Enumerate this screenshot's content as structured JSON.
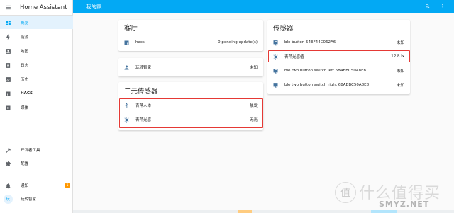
{
  "sidebar": {
    "title": "Home Assistant",
    "items": [
      {
        "label": "概览",
        "icon": "dashboard-icon"
      },
      {
        "label": "能源",
        "icon": "lightning-icon"
      },
      {
        "label": "地图",
        "icon": "map-person-icon"
      },
      {
        "label": "日志",
        "icon": "logbook-icon"
      },
      {
        "label": "历史",
        "icon": "history-chart-icon"
      },
      {
        "label": "HACS",
        "icon": "hacs-icon"
      },
      {
        "label": "媒体",
        "icon": "media-icon"
      }
    ],
    "bottom_items": [
      {
        "label": "开发者工具",
        "icon": "hammer-icon"
      },
      {
        "label": "配置",
        "icon": "gear-icon"
      }
    ],
    "notifications": {
      "label": "通知",
      "count": "1"
    },
    "user": {
      "name": "玩转智家",
      "initial": "玩"
    }
  },
  "header": {
    "title": "我的家"
  },
  "cards": {
    "living_room": {
      "title": "客厅",
      "rows": [
        {
          "name": "hacs",
          "state": "0 pending update(s)"
        }
      ]
    },
    "person": {
      "rows": [
        {
          "name": "玩转智家",
          "state": "未知"
        }
      ]
    },
    "binary_sensors": {
      "title": "二元传感器",
      "rows": [
        {
          "name": "青萍人体",
          "state": "触发"
        },
        {
          "name": "青萍光感",
          "state": "无光"
        }
      ]
    },
    "sensors": {
      "title": "传感器",
      "rows": [
        {
          "name": "ble button 54EF44C062A6",
          "state": "未知"
        },
        {
          "name": "青萍光感值",
          "state": "12.8 lx"
        },
        {
          "name": "ble two button switch left 68ABBC50A8E8",
          "state": "未知"
        },
        {
          "name": "ble two button switch right 68ABBC50A8E8",
          "state": "未知"
        }
      ]
    }
  },
  "watermark": {
    "cn": "值 什么值得买",
    "en": "SMYZ.NET"
  },
  "colors": {
    "accent": "#03a9f4",
    "highlight": "#e53935",
    "icon": "#44739e"
  }
}
